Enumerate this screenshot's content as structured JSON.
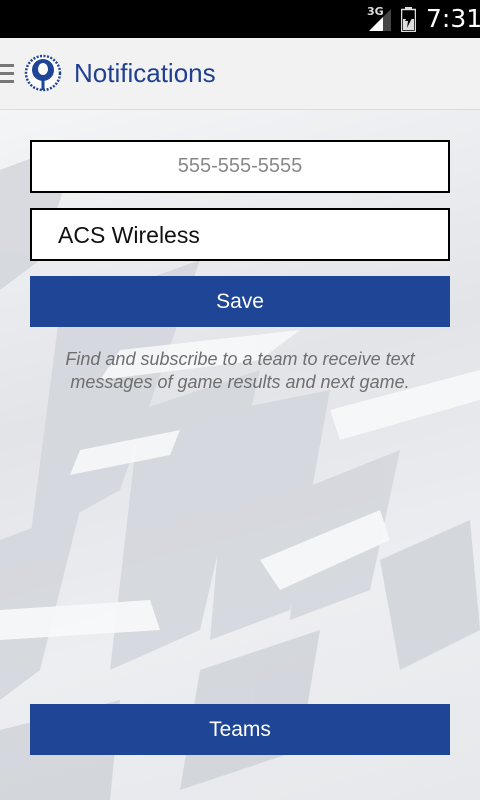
{
  "status_bar": {
    "network": "3G",
    "time": "7:31"
  },
  "header": {
    "title": "Notifications",
    "logo_icon": "stadium-logo-icon",
    "menu_icon": "drawer-menu-icon"
  },
  "form": {
    "phone_placeholder": "555-555-5555",
    "phone_value": "",
    "carrier_value": "ACS Wireless",
    "save_label": "Save"
  },
  "hint_text": "Find and subscribe to a team to receive text messages of game results and next game.",
  "footer": {
    "teams_label": "Teams"
  },
  "colors": {
    "accent": "#1f4596",
    "title": "#1f3f8f"
  }
}
